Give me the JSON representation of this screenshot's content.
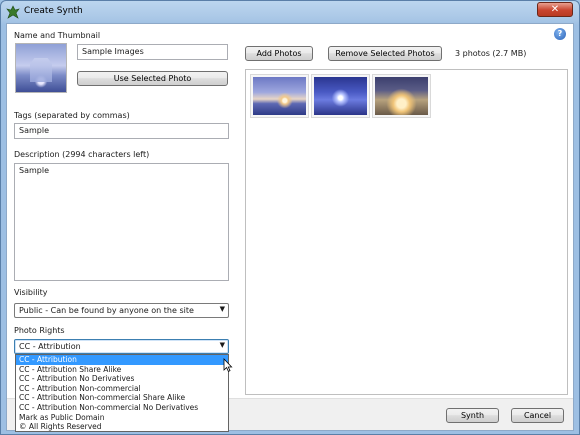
{
  "window": {
    "title": "Create Synth",
    "close_label": "✕",
    "help_label": "?"
  },
  "name_section": {
    "label": "Name and Thumbnail",
    "name_value": "Sample Images",
    "use_selected_label": "Use Selected Photo"
  },
  "tags": {
    "label": "Tags (separated by commas)",
    "value": "Sample"
  },
  "description": {
    "label": "Description (2994 characters left)",
    "value": "Sample"
  },
  "visibility": {
    "label": "Visibility",
    "selected": "Public - Can be found by anyone on the site"
  },
  "photo_rights": {
    "label": "Photo Rights",
    "selected": "CC - Attribution",
    "options": [
      "CC - Attribution",
      "CC - Attribution Share Alike",
      "CC - Attribution No Derivatives",
      "CC - Attribution Non-commercial",
      "CC - Attribution Non-commercial Share Alike",
      "CC - Attribution Non-commercial No Derivatives",
      "Mark as Public Domain",
      "© All Rights Reserved"
    ]
  },
  "photos": {
    "add_label": "Add Photos",
    "remove_label": "Remove Selected Photos",
    "count_text": "3 photos (2.7 MB)"
  },
  "footer": {
    "synth_label": "Synth",
    "cancel_label": "Cancel"
  },
  "colors": {
    "selection": "#3399ff",
    "close_button": "#c9452f"
  }
}
